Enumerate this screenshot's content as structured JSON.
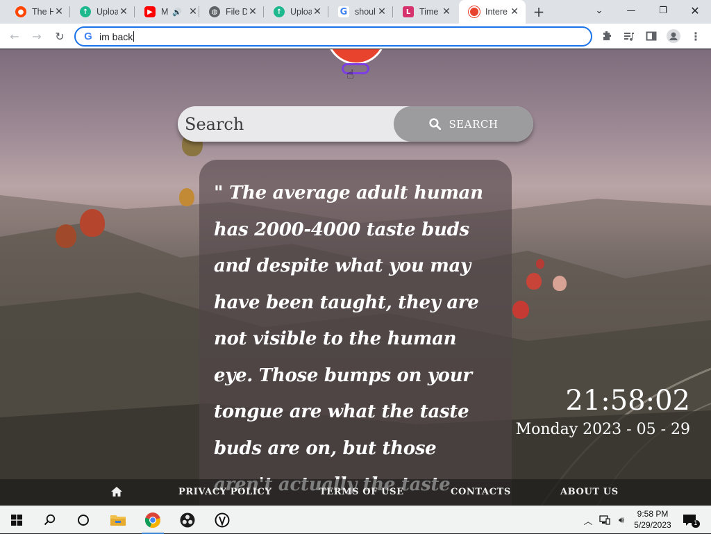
{
  "tabs": [
    {
      "title": "The H",
      "favicon": "reddit-like",
      "color": "#ff4500"
    },
    {
      "title": "Uploa",
      "favicon": "upload-icon",
      "color": "#1db88e"
    },
    {
      "title": "M",
      "favicon": "youtube-icon",
      "color": "#ff0000",
      "audio": true
    },
    {
      "title": "File D",
      "favicon": "globe-icon",
      "color": "#5f6368"
    },
    {
      "title": "Uploa",
      "favicon": "upload-icon",
      "color": "#1db88e"
    },
    {
      "title": "shoul",
      "favicon": "google-icon",
      "color": "#4285f4"
    },
    {
      "title": "Time",
      "favicon": "time-icon",
      "color": "#d6336c"
    },
    {
      "title": "Intere",
      "favicon": "site-icon",
      "color": "#e8432c",
      "active": true
    }
  ],
  "omnibox": {
    "value": "im back"
  },
  "search": {
    "placeholder": "Search",
    "button_label": "SEARCH"
  },
  "fact": {
    "text": "\"  The average adult human has 2000-4000 taste buds and despite what you may have been taught, they are not visible to the human eye. Those bumps on your tongue are what the taste buds are on, but those aren't actually the taste buds themselves.  \""
  },
  "clock": {
    "time": "21:58:02",
    "date": "Monday 2023 - 05 - 29"
  },
  "footer": {
    "privacy": "PRIVACY POLICY",
    "terms": "TERMS OF USE",
    "contacts": "CONTACTS",
    "about": "ABOUT US"
  },
  "taskbar": {
    "time": "9:58 PM",
    "date": "5/29/2023",
    "notification_count": "1"
  }
}
